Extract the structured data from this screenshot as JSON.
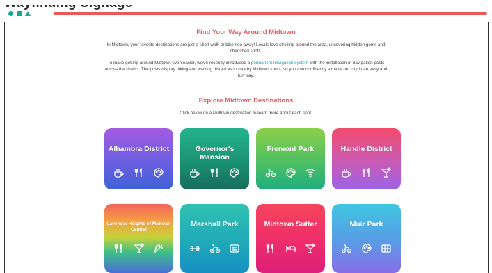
{
  "header": {
    "title": "Wayfinding Signage"
  },
  "intro": {
    "heading": "Find Your Way Around Midtown",
    "para1": "In Midtown, your favorite destinations are just a short walk or bike ride away! Locals love strolling around the area, uncovering hidden gems and cherished spots.",
    "para2_a": "To make getting around Midtown even easier, we've recently introduced a ",
    "para2_link": "permanent navigation system",
    "para2_b": " with the installation of navigation posts across the district. The posts display biking and walking distances to nearby Midtown spots, so you can confidently explore our city in an easy and fun way."
  },
  "explore": {
    "heading": "Explore Midtown Destinations",
    "subtitle": "Click below on a Midtown destination to learn more about each spot."
  },
  "cards": [
    {
      "name": "Alhambra District",
      "icons": [
        "coffee-icon",
        "dining-icon",
        "palette-icon"
      ]
    },
    {
      "name": "Governor's Mansion",
      "icons": [
        "coffee-icon",
        "dining-icon",
        "palette-icon"
      ]
    },
    {
      "name": "Fremont Park",
      "icons": [
        "bike-icon",
        "palette-icon",
        "wifi-icon"
      ]
    },
    {
      "name": "Handle District",
      "icons": [
        "coffee-icon",
        "dining-icon",
        "cocktail-icon"
      ]
    },
    {
      "name": "Lavender Heights of Midtown Central",
      "icons": [
        "dining-icon",
        "cocktail-icon",
        "carrot-icon"
      ]
    },
    {
      "name": "Marshall Park",
      "icons": [
        "dumbbell-icon",
        "bike-icon",
        "parking-icon"
      ]
    },
    {
      "name": "Midtown Sutter",
      "icons": [
        "dining-icon",
        "bed-icon",
        "cocktail-icon"
      ]
    },
    {
      "name": "Muir Park",
      "icons": [
        "bike-icon",
        "palette-icon",
        "grid-icon"
      ]
    }
  ]
}
